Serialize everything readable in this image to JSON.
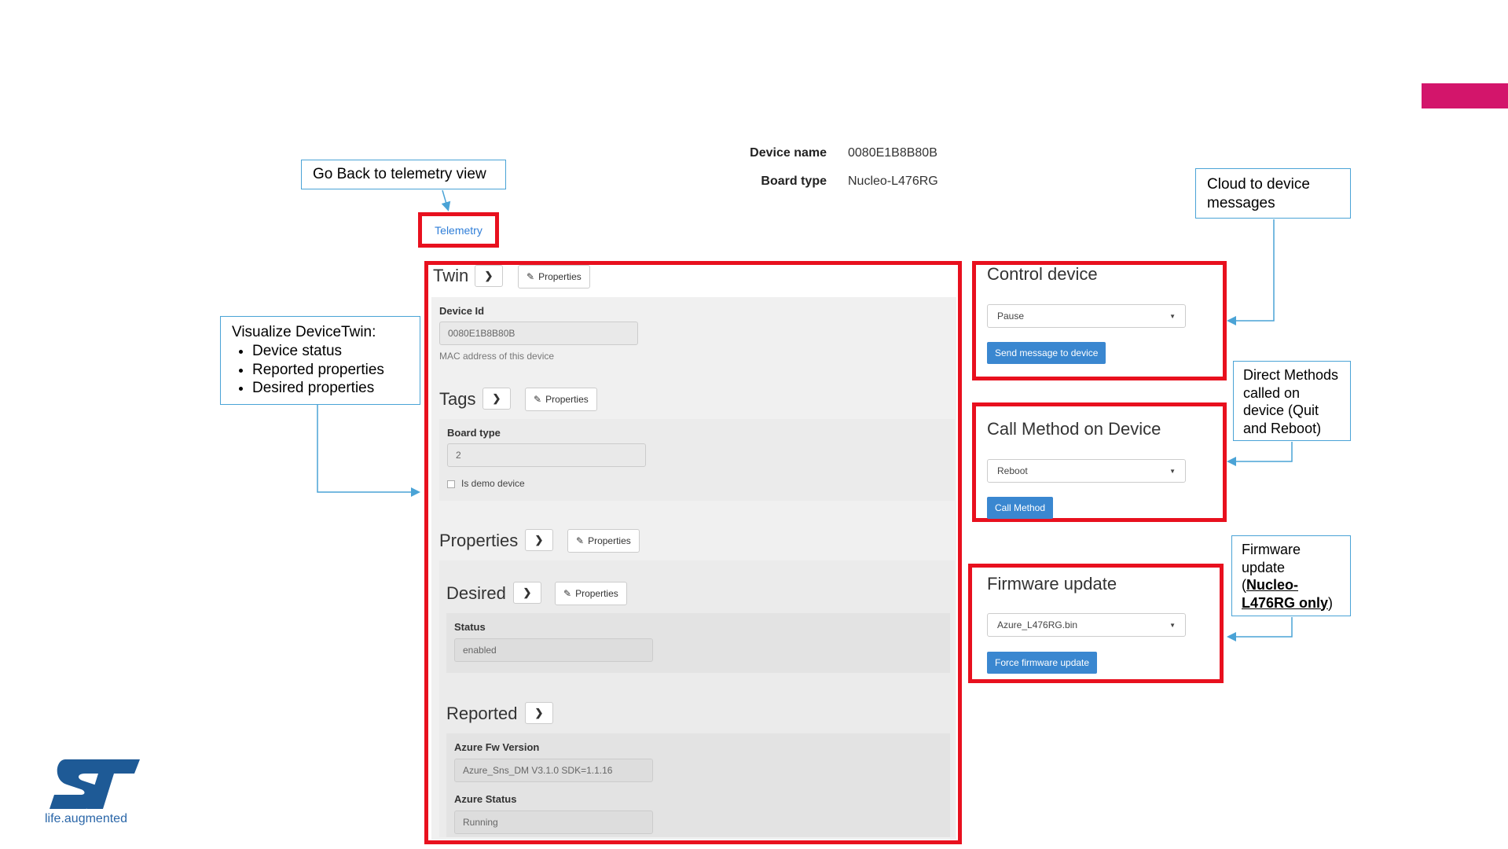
{
  "header": {
    "device_name_label": "Device name",
    "device_name_value": "0080E1B8B80B",
    "board_type_label": "Board type",
    "board_type_value": "Nucleo-L476RG"
  },
  "callouts": {
    "go_back": "Go Back to telemetry view",
    "devicetwin_title": "Visualize DeviceTwin:",
    "devicetwin_items": [
      "Device status",
      "Reported properties",
      "Desired properties"
    ],
    "cloud_msgs": "Cloud to device messages",
    "direct_methods": "Direct Methods called on device (Quit and Reboot)",
    "firmware_prefix": "Firmware update (",
    "firmware_bold": "Nucleo-L476RG only",
    "firmware_suffix": ")"
  },
  "telemetry_link": "Telemetry",
  "twin": {
    "title": "Twin",
    "properties_btn": "Properties",
    "device_id_label": "Device Id",
    "device_id_value": "0080E1B8B80B",
    "device_id_help": "MAC address of this device",
    "tags": {
      "title": "Tags",
      "properties_btn": "Properties",
      "board_type_label": "Board type",
      "board_type_value": "2",
      "demo_label": "Is demo device"
    },
    "properties": {
      "title": "Properties",
      "properties_btn": "Properties",
      "desired": {
        "title": "Desired",
        "properties_btn": "Properties",
        "status_label": "Status",
        "status_value": "enabled"
      },
      "reported": {
        "title": "Reported",
        "fw_label": "Azure Fw Version",
        "fw_value": "Azure_Sns_DM V3.1.0 SDK=1.1.16",
        "status_label": "Azure Status",
        "status_value": "Running"
      }
    }
  },
  "control": {
    "title": "Control device",
    "select": "Pause",
    "button": "Send message to device"
  },
  "method": {
    "title": "Call Method on Device",
    "select": "Reboot",
    "button": "Call Method"
  },
  "firmware": {
    "title": "Firmware update",
    "select": "Azure_L476RG.bin",
    "button": "Force firmware update"
  },
  "logo": {
    "tagline_a": "life",
    "tagline_dot": ".",
    "tagline_b": "augmented"
  },
  "colors": {
    "accent": "#d3156b",
    "highlight_red": "#e8101e",
    "callout_border": "#4aa3d6",
    "button_blue": "#3a87d0"
  }
}
